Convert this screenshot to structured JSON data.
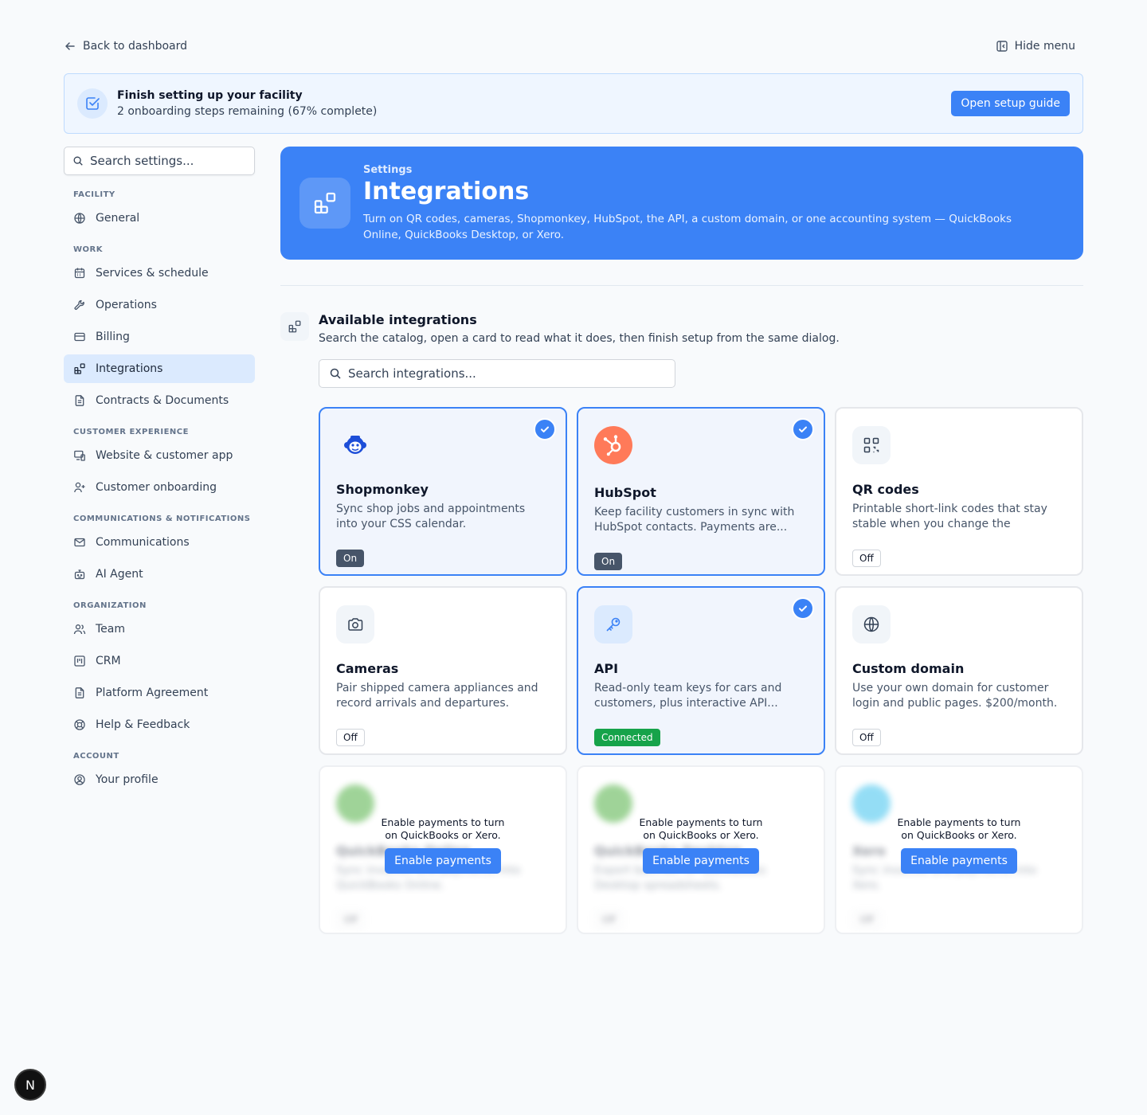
{
  "topbar": {
    "back_label": "Back to dashboard",
    "hide_menu_label": "Hide menu"
  },
  "setup_banner": {
    "title": "Finish setting up your facility",
    "subtitle": "2 onboarding steps remaining (67% complete)",
    "button_label": "Open setup guide"
  },
  "sidebar": {
    "search_placeholder": "Search settings...",
    "groups": [
      {
        "title": "FACILITY",
        "items": [
          {
            "label": "General",
            "icon": "globe-icon"
          }
        ]
      },
      {
        "title": "WORK",
        "items": [
          {
            "label": "Services & schedule",
            "icon": "calendar-icon"
          },
          {
            "label": "Operations",
            "icon": "wrench-icon"
          },
          {
            "label": "Billing",
            "icon": "credit-card-icon"
          },
          {
            "label": "Integrations",
            "icon": "blocks-icon",
            "active": true
          },
          {
            "label": "Contracts & Documents",
            "icon": "document-icon"
          }
        ]
      },
      {
        "title": "CUSTOMER EXPERIENCE",
        "items": [
          {
            "label": "Website & customer app",
            "icon": "devices-icon"
          },
          {
            "label": "Customer onboarding",
            "icon": "user-plus-icon"
          }
        ]
      },
      {
        "title": "COMMUNICATIONS & NOTIFICATIONS",
        "items": [
          {
            "label": "Communications",
            "icon": "mail-icon"
          },
          {
            "label": "AI Agent",
            "icon": "bot-icon"
          }
        ]
      },
      {
        "title": "ORGANIZATION",
        "items": [
          {
            "label": "Team",
            "icon": "users-icon"
          },
          {
            "label": "CRM",
            "icon": "kanban-icon"
          },
          {
            "label": "Platform Agreement",
            "icon": "document-icon"
          },
          {
            "label": "Help & Feedback",
            "icon": "lifebuoy-icon"
          }
        ]
      },
      {
        "title": "ACCOUNT",
        "items": [
          {
            "label": "Your profile",
            "icon": "user-circle-icon"
          }
        ]
      }
    ]
  },
  "hero": {
    "eyebrow": "Settings",
    "title": "Integrations",
    "description": "Turn on QR codes, cameras, Shopmonkey, HubSpot, the API, a custom domain, or one accounting system — QuickBooks Online, QuickBooks Desktop, or Xero."
  },
  "available": {
    "title": "Available integrations",
    "subtitle": "Search the catalog, open a card to read what it does, then finish setup from the same dialog.",
    "search_placeholder": "Search integrations..."
  },
  "cards": [
    {
      "key": "shopmonkey",
      "name": "Shopmonkey",
      "desc": "Sync shop jobs and appointments into your CSS calendar.",
      "status": "On",
      "status_kind": "on",
      "enabled": true,
      "icon": "shopmonkey-logo-icon"
    },
    {
      "key": "hubspot",
      "name": "HubSpot",
      "desc": "Keep facility customers in sync with HubSpot contacts. Payments are...",
      "status": "On",
      "status_kind": "on",
      "enabled": true,
      "icon": "hubspot-logo-icon"
    },
    {
      "key": "qr",
      "name": "QR codes",
      "desc": "Printable short-link codes that stay stable when you change the destination.",
      "status": "Off",
      "status_kind": "off",
      "enabled": false,
      "icon": "qr-code-icon"
    },
    {
      "key": "cameras",
      "name": "Cameras",
      "desc": "Pair shipped camera appliances and record arrivals and departures.",
      "status": "Off",
      "status_kind": "off",
      "enabled": false,
      "icon": "camera-icon"
    },
    {
      "key": "api",
      "name": "API",
      "desc": "Read-only team keys for cars and customers, plus interactive API...",
      "status": "Connected",
      "status_kind": "connected",
      "enabled": true,
      "icon": "key-icon"
    },
    {
      "key": "domain",
      "name": "Custom domain",
      "desc": "Use your own domain for customer login and public pages. $200/month.",
      "status": "Off",
      "status_kind": "off",
      "enabled": false,
      "icon": "globe-icon"
    }
  ],
  "locked_cards": [
    {
      "key": "qbo",
      "name": "QuickBooks Online",
      "desc": "Sync invoices and payments into QuickBooks Online.",
      "status": "Off",
      "icon": "quickbooks-logo-icon",
      "logo_color": "#2ca01c",
      "overlay_text": "Enable payments to turn on QuickBooks or Xero.",
      "button_label": "Enable payments"
    },
    {
      "key": "qbd",
      "name": "QuickBooks Desktop",
      "desc": "Export batches for QuickBooks Desktop spreadsheets.",
      "status": "Off",
      "icon": "quickbooks-logo-icon",
      "logo_color": "#2ca01c",
      "overlay_text": "Enable payments to turn on QuickBooks or Xero.",
      "button_label": "Enable payments"
    },
    {
      "key": "xero",
      "name": "Xero",
      "desc": "Sync invoices and payments into Xero.",
      "status": "Off",
      "icon": "xero-logo-icon",
      "logo_color": "#13b5ea",
      "overlay_text": "Enable payments to turn on QuickBooks or Xero.",
      "button_label": "Enable payments"
    }
  ],
  "dev_badge": {
    "label": "N"
  },
  "colors": {
    "accent": "#3b82f6",
    "enabled_border": "#3b82f6",
    "connected": "#16a34a",
    "hubspot": "#ff7a59",
    "shopmonkey": "#2563eb"
  }
}
